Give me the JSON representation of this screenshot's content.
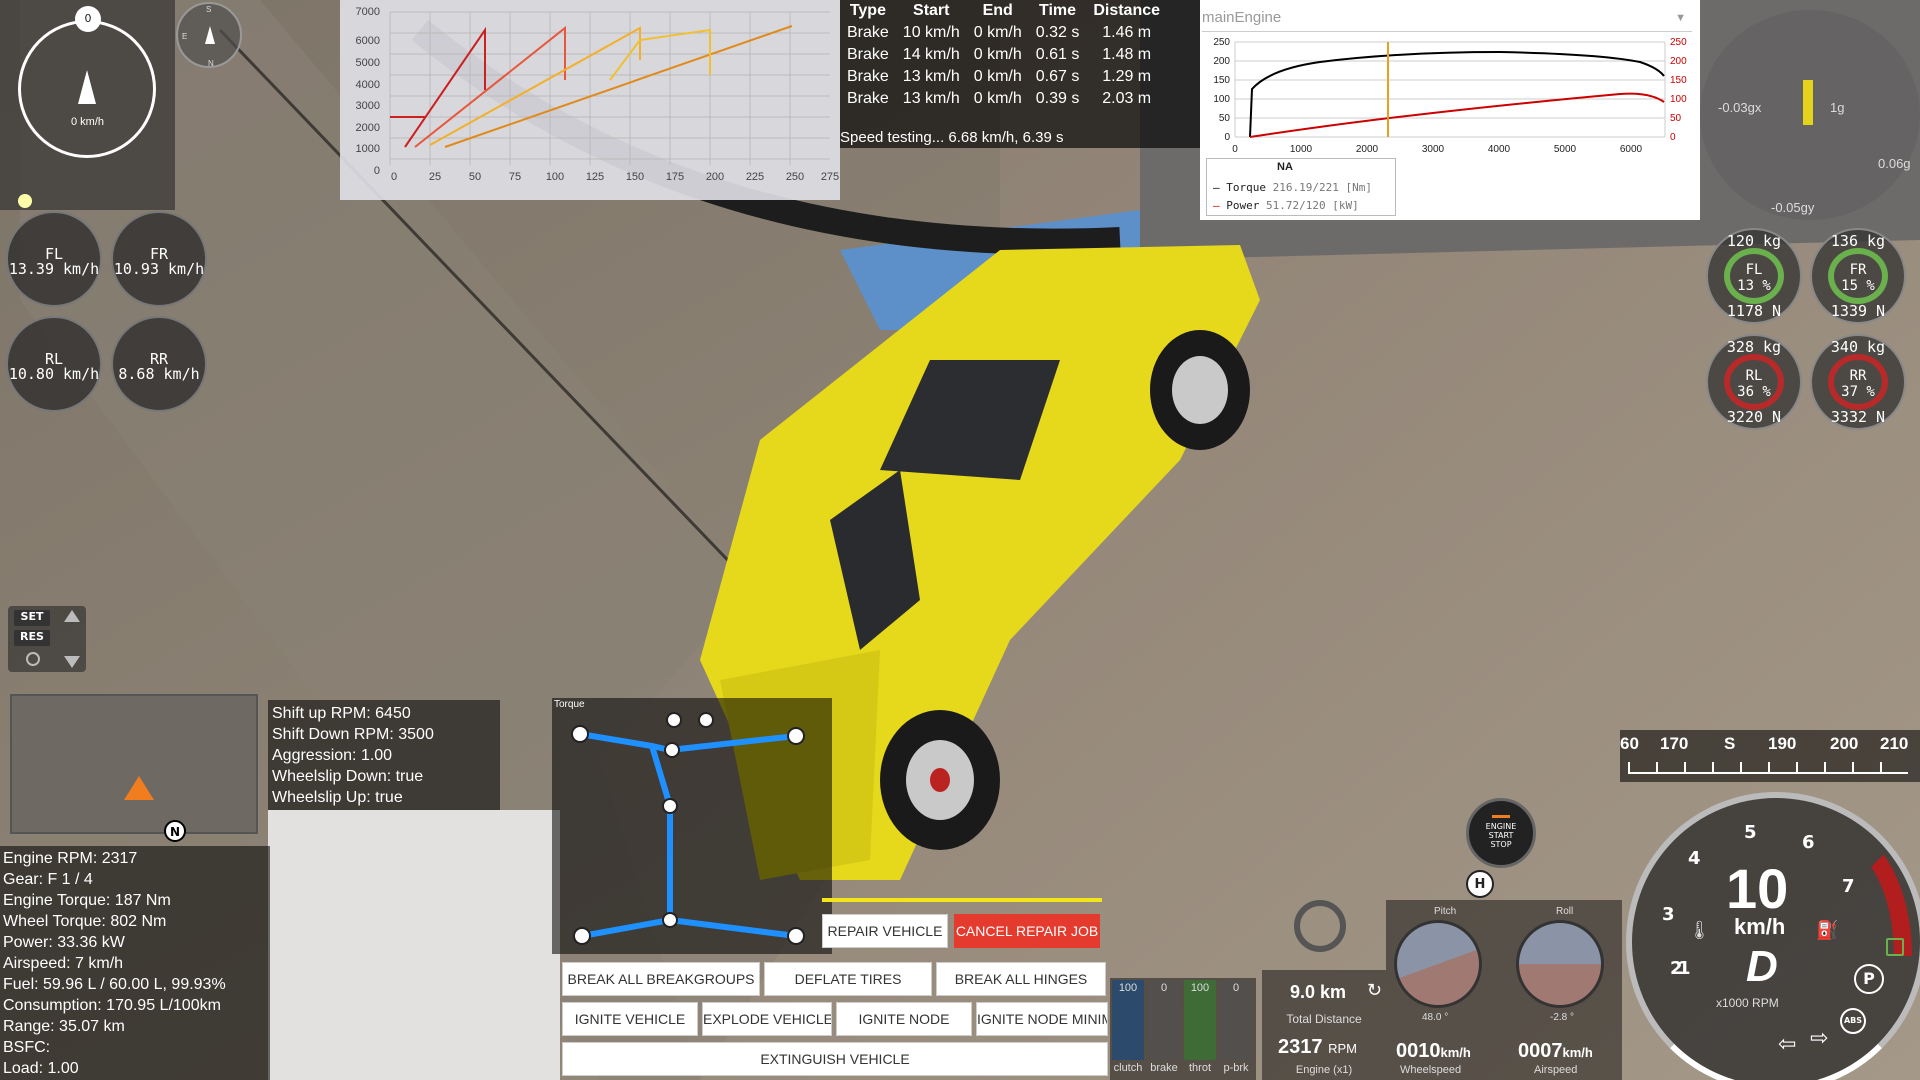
{
  "compass": {
    "heading_speed": "0 km/h",
    "mark": "0",
    "dirs": [
      "S",
      "E",
      "N"
    ]
  },
  "wheels": [
    {
      "name": "FL",
      "speed": "13.39 km/h"
    },
    {
      "name": "FR",
      "speed": "10.93 km/h"
    },
    {
      "name": "RL",
      "speed": "10.80 km/h"
    },
    {
      "name": "RR",
      "speed": "8.68 km/h"
    }
  ],
  "tires": [
    {
      "name": "FL",
      "kg": "120 kg",
      "pct": "13 %",
      "force": "1178 N"
    },
    {
      "name": "FR",
      "kg": "136 kg",
      "pct": "15 %",
      "force": "1339 N"
    },
    {
      "name": "RL",
      "kg": "328 kg",
      "pct": "36 %",
      "force": "3220 N"
    },
    {
      "name": "RR",
      "kg": "340 kg",
      "pct": "37 %",
      "force": "3332 N"
    }
  ],
  "gforce": {
    "x": "-0.03gx",
    "y": "-0.05gy",
    "g1": "1g",
    "g2": "0.06g"
  },
  "cruise": {
    "set": "SET",
    "res": "RES"
  },
  "minimap": {
    "north": "N"
  },
  "shift_info": {
    "lines": [
      "Shift up RPM: 6450",
      "Shift Down RPM: 3500",
      "Aggression: 1.00",
      "Wheelslip Down: true",
      "Wheelslip Up: true"
    ]
  },
  "engine_info": {
    "lines": [
      "Engine RPM: 2317",
      "Gear: F 1 / 4",
      "Engine Torque: 187 Nm",
      "Wheel Torque: 802 Nm",
      "Power: 33.36 kW",
      "Airspeed: 7 km/h",
      "Fuel: 59.96 L / 60.00 L, 99.93%",
      "Consumption: 170.95 L/100km",
      "Range: 35.07 km",
      "BSFC:",
      "Load: 1.00"
    ]
  },
  "shift_chart": {
    "yticks": [
      "7000",
      "6000",
      "5000",
      "4000",
      "3000",
      "2000",
      "1000",
      "0"
    ],
    "xticks": [
      "0",
      "25",
      "50",
      "75",
      "100",
      "125",
      "150",
      "175",
      "200",
      "225",
      "250",
      "275"
    ]
  },
  "brake_table": {
    "headers": [
      "Type",
      "Start",
      "End",
      "Time",
      "Distance"
    ],
    "rows": [
      [
        "Brake",
        "10 km/h",
        "0 km/h",
        "0.32 s",
        "1.46 m"
      ],
      [
        "Brake",
        "14 km/h",
        "0 km/h",
        "0.61 s",
        "1.48 m"
      ],
      [
        "Brake",
        "13 km/h",
        "0 km/h",
        "0.67 s",
        "1.29 m"
      ],
      [
        "Brake",
        "13 km/h",
        "0 km/h",
        "0.39 s",
        "2.03 m"
      ]
    ],
    "status": "Speed testing... 6.68 km/h, 6.39 s"
  },
  "engine_chart": {
    "select": "mainEngine",
    "left_ticks": [
      "250",
      "200",
      "150",
      "100",
      "50",
      "0"
    ],
    "right_ticks": [
      "250",
      "200",
      "150",
      "100",
      "50",
      "0"
    ],
    "xticks": [
      "0",
      "1000",
      "2000",
      "3000",
      "4000",
      "5000",
      "6000"
    ],
    "legend_title": "NA",
    "legend": [
      {
        "label": "Torque",
        "value": "216.19/221 [Nm]",
        "color": "#000000"
      },
      {
        "label": "Power",
        "value": "51.72/120 [kW]",
        "color": "#cc0000"
      }
    ]
  },
  "torque_panel": {
    "title": "Torque"
  },
  "actions": {
    "repair": "REPAIR VEHICLE",
    "cancel": "CANCEL REPAIR JOB",
    "break_groups": "BREAK ALL BREAKGROUPS",
    "deflate": "DEFLATE TIRES",
    "break_hinges": "BREAK ALL HINGES",
    "ignite_vehicle": "IGNITE VEHICLE",
    "explode": "EXPLODE VEHICLE",
    "ignite_node": "IGNITE NODE",
    "ignite_node_mini": "IGNITE NODE MINIM",
    "extinguish": "EXTINGUISH VEHICLE"
  },
  "pedals": [
    {
      "label": "clutch",
      "value": "100"
    },
    {
      "label": "brake",
      "value": "0"
    },
    {
      "label": "throt",
      "value": "100"
    },
    {
      "label": "p-brk",
      "value": "0"
    }
  ],
  "trip": {
    "distance": "9.0 km",
    "distance_label": "Total Distance",
    "rpm": "2317",
    "rpm_unit": "RPM",
    "rpm_label": "Engine (x1)"
  },
  "speeds": {
    "wheel": "0010",
    "wheel_unit": "km/h",
    "wheel_label": "Wheelspeed",
    "air": "0007",
    "air_unit": "km/h",
    "air_label": "Airspeed"
  },
  "attitude": {
    "pitch_label": "Pitch",
    "pitch_val": "48.0 °",
    "roll_label": "Roll",
    "roll_val": "-2.8 °"
  },
  "engine_btn": {
    "line1": "ENGINE",
    "line2": "START",
    "line3": "STOP"
  },
  "heading_tape": {
    "labels": [
      "60",
      "170",
      "S",
      "190",
      "200",
      "210"
    ]
  },
  "dash": {
    "speed": "10",
    "unit": "km/h",
    "gear": "D",
    "rpm_label": "x1000 RPM",
    "ticks": [
      "1",
      "2",
      "3",
      "4",
      "5",
      "6",
      "7"
    ]
  },
  "colors": {
    "accent_red": "#e53a2e",
    "torque_line": "#000000",
    "power_line": "#cc0000",
    "car_yellow": "#e6d81a",
    "blue_node": "#1e90ff"
  }
}
